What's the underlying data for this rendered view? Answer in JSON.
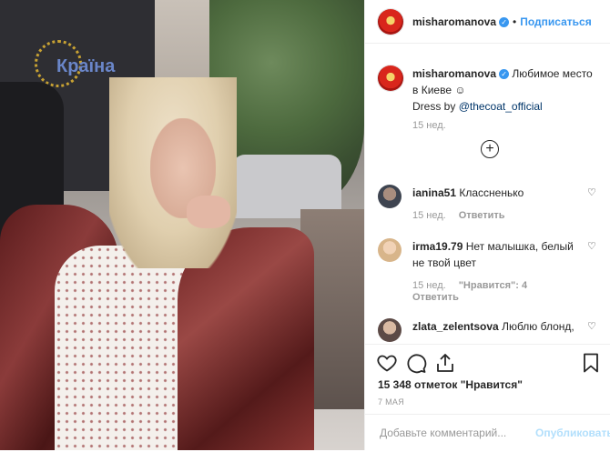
{
  "header": {
    "username": "misharomanova",
    "separator": "•",
    "follow_label": "Подписаться"
  },
  "caption": {
    "username": "misharomanova",
    "text": "Любимое место в Киеве ☺",
    "dress_prefix": "Dress by ",
    "mention": "@thecoat_official",
    "time": "15 нед."
  },
  "comments": [
    {
      "username": "ianina51",
      "text": "Классненько",
      "time": "15 нед.",
      "reply": "Ответить"
    },
    {
      "username": "irma19.79",
      "text": "Нет малышка, белый не твой цвет",
      "time": "15 нед.",
      "likes": "\"Нравится\": 4",
      "reply": "Ответить"
    },
    {
      "username": "zlata_zelentsova",
      "text": "Люблю блонд,"
    }
  ],
  "actions": {
    "likes": "15 348 отметок \"Нравится\"",
    "date": "7 МАЯ"
  },
  "comment_box": {
    "placeholder": "Добавьте комментарий...",
    "publish": "Опубликовать"
  },
  "photo": {
    "sign_text": "Країна"
  },
  "icons": {
    "heart": "heart-icon",
    "comment": "comment-icon",
    "share": "share-icon",
    "save": "bookmark-icon",
    "load_more": "plus-circle-icon",
    "verified": "verified-badge-icon"
  },
  "colors": {
    "link": "#3897f0",
    "mention": "#003569",
    "muted": "#999999",
    "publish_disabled": "#b2dffc"
  }
}
